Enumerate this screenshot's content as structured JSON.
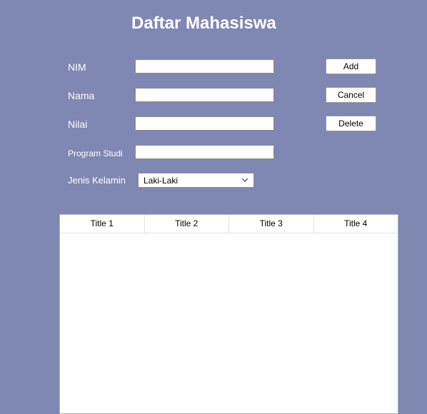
{
  "title": "Daftar Mahasiswa",
  "form": {
    "nim_label": "NIM",
    "nama_label": "Nama",
    "nilai_label": "Nilai",
    "program_studi_label": "Program Studi",
    "jenis_kelamin_label": "Jenis Kelamin",
    "nim_value": "",
    "nama_value": "",
    "nilai_value": "",
    "program_studi_value": "",
    "jenis_kelamin_selected": "Laki-Laki"
  },
  "buttons": {
    "add": "Add",
    "cancel": "Cancel",
    "delete": "Delete"
  },
  "table": {
    "columns": [
      "Title 1",
      "Title 2",
      "Title 3",
      "Title 4"
    ],
    "rows": []
  },
  "icons": {
    "dropdown": "chevron-down-icon"
  }
}
